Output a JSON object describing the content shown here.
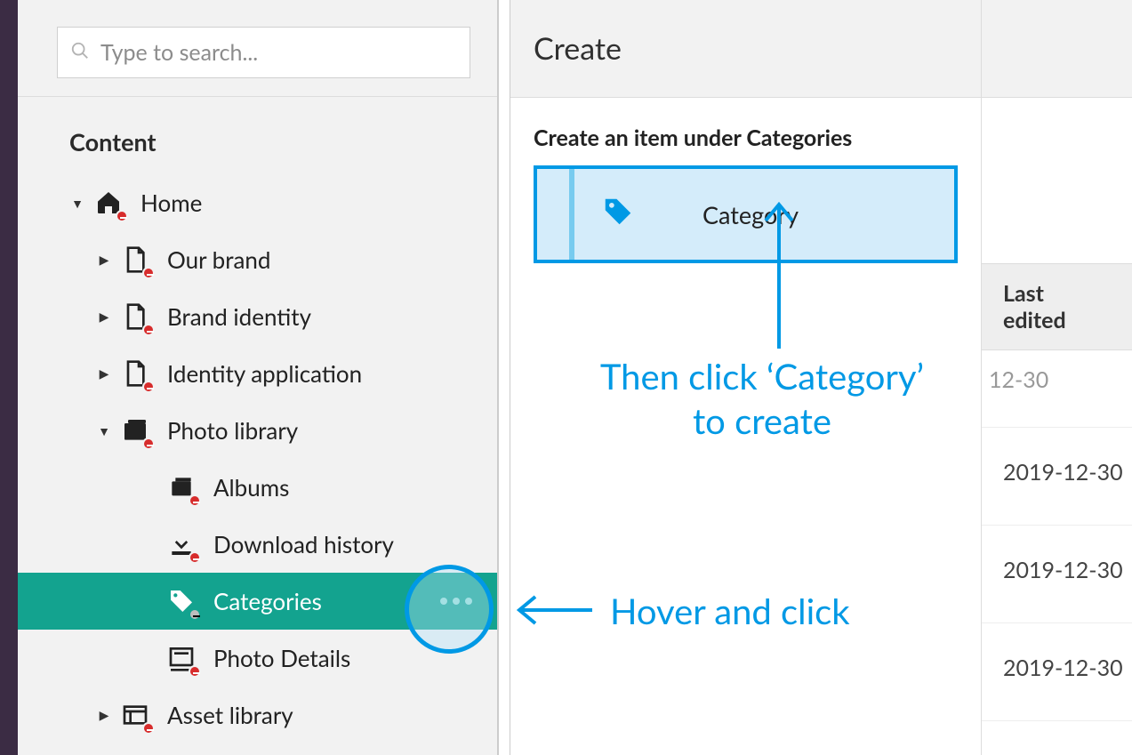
{
  "search": {
    "placeholder": "Type to search..."
  },
  "sidebar": {
    "section_label": "Content",
    "tree": {
      "home": "Home",
      "our_brand": "Our brand",
      "brand_identity": "Brand identity",
      "identity_application": "Identity application",
      "photo_library": "Photo library",
      "albums": "Albums",
      "download_history": "Download history",
      "categories": "Categories",
      "photo_details": "Photo Details",
      "asset_library": "Asset library"
    }
  },
  "panel": {
    "title": "Create",
    "subtitle": "Create an item under Categories",
    "option_label": "Category"
  },
  "column": {
    "header": "Last edited"
  },
  "dates": {
    "d1": "12-30",
    "d2": "2019-12-30",
    "d3": "2019-12-30",
    "d4": "2019-12-30"
  },
  "annotations": {
    "step2": "Then click ‘Category’\nto create",
    "step1": "Hover and click"
  }
}
